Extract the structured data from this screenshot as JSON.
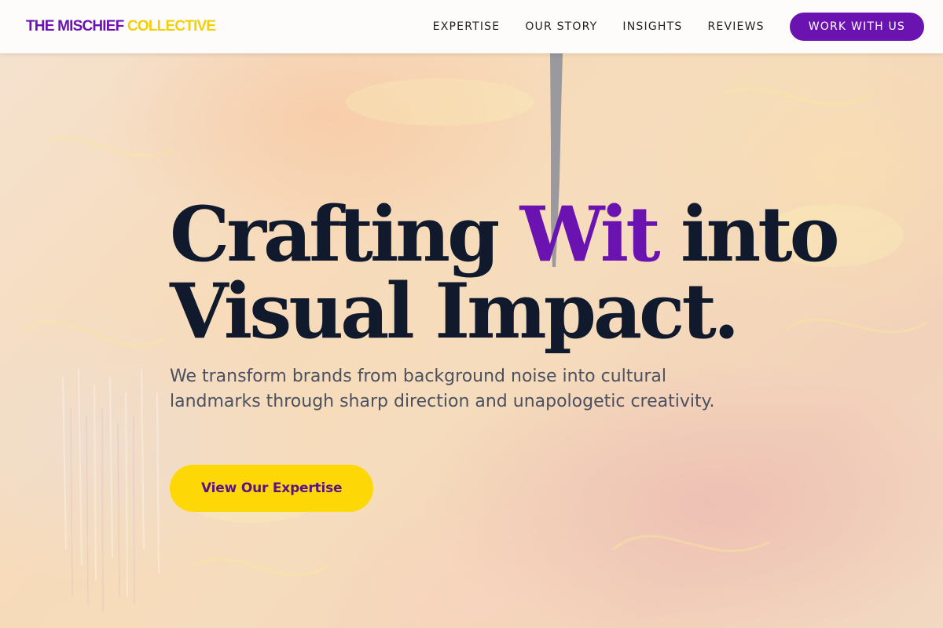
{
  "brand": {
    "name_part1": "THE MISCHIEF",
    "name_part2": "COLLECTIVE",
    "primary_color": "#6b13b0",
    "accent_color": "#f2cf07"
  },
  "nav": {
    "items": [
      {
        "label": "EXPERTISE"
      },
      {
        "label": "OUR STORY"
      },
      {
        "label": "INSIGHTS"
      },
      {
        "label": "REVIEWS"
      }
    ],
    "cta_label": "WORK WITH US"
  },
  "hero": {
    "headline_part1": "Crafting ",
    "headline_accent": "Wit",
    "headline_part2": " into",
    "headline_line2": "Visual Impact.",
    "subtext": "We transform brands from background noise into cultural landmarks through sharp direction and unapologetic creativity.",
    "cta_label": "View Our Expertise",
    "cta_color": "#fdd806",
    "heading_color": "#111a2c"
  }
}
